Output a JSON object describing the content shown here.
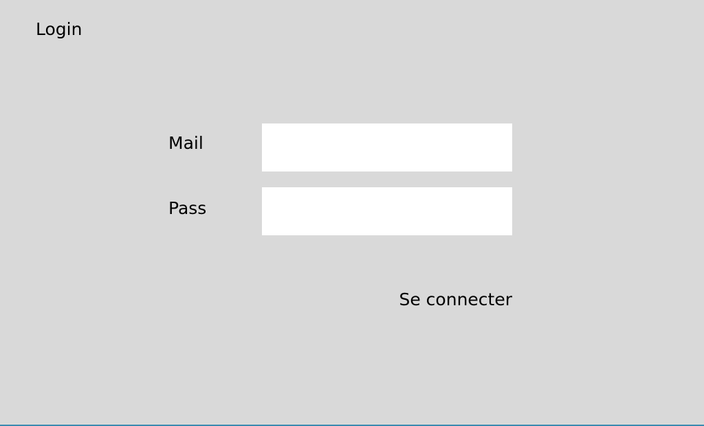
{
  "app": {
    "title": "Login"
  },
  "form": {
    "mail": {
      "label": "Mail",
      "value": "",
      "placeholder": ""
    },
    "pass": {
      "label": "Pass",
      "value": "",
      "placeholder": ""
    },
    "submit_label": "Se connecter"
  },
  "colors": {
    "background": "#d9d9d9",
    "input_background": "#ffffff",
    "text": "#000000",
    "bottom_border": "#3a8ab0"
  }
}
